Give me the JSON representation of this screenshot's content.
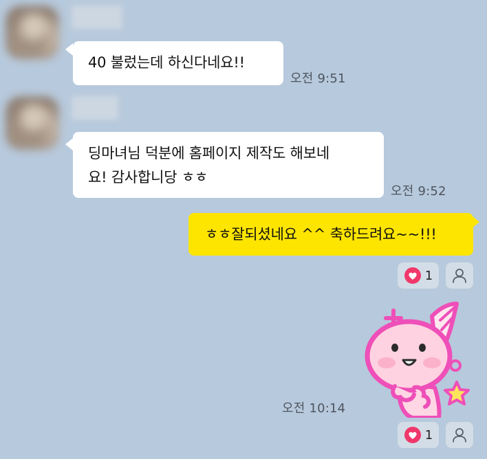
{
  "messages": [
    {
      "text": "40 불렀는데 하신다네요!!",
      "time": "오전 9:51"
    },
    {
      "line1": "딩마녀님 덕분에 홈페이지 제작도 해보네",
      "line2": "요! 감사합니당 ㅎㅎ",
      "time": "오전 9:52"
    },
    {
      "text": "ㅎㅎ잘되셨네요 ^^ 축하드려요~~!!!"
    }
  ],
  "reactions": [
    {
      "icon": "heart-icon",
      "count": "1"
    },
    {
      "icon": "heart-icon",
      "count": "1"
    }
  ],
  "sticker": {
    "time": "오전 10:14"
  },
  "colors": {
    "background": "#b7c9dc",
    "received_bubble": "#ffffff",
    "sent_bubble": "#fee500",
    "heart": "#f0386b"
  }
}
